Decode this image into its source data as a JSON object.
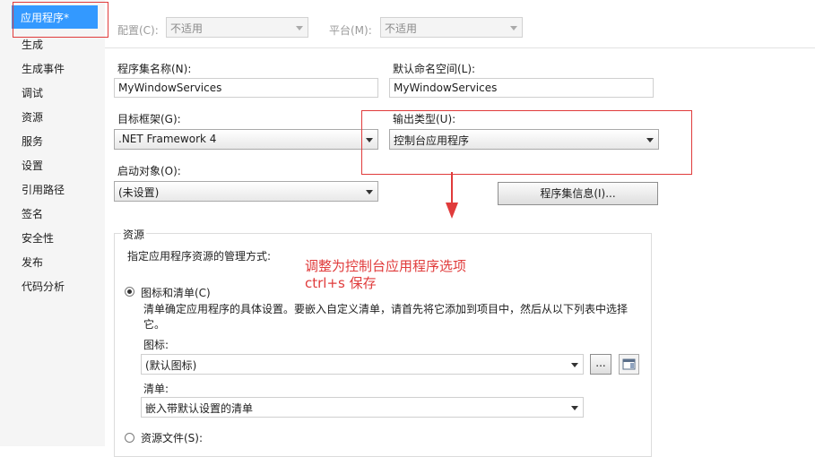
{
  "sidebar": {
    "active": "应用程序*",
    "items": [
      "生成",
      "生成事件",
      "调试",
      "资源",
      "服务",
      "设置",
      "引用路径",
      "签名",
      "安全性",
      "发布",
      "代码分析"
    ]
  },
  "toolbar": {
    "config_label": "配置(C):",
    "config_value": "不适用",
    "platform_label": "平台(M):",
    "platform_value": "不适用"
  },
  "form": {
    "assembly_name_label": "程序集名称(N):",
    "assembly_name_value": "MyWindowServices",
    "namespace_label": "默认命名空间(L):",
    "namespace_value": "MyWindowServices",
    "target_framework_label": "目标框架(G):",
    "target_framework_value": ".NET Framework 4",
    "output_type_label": "输出类型(U):",
    "output_type_value": "控制台应用程序",
    "startup_object_label": "启动对象(O):",
    "startup_object_value": "(未设置)",
    "assembly_info_button": "程序集信息(I)..."
  },
  "resources": {
    "group_title": "资源",
    "intro": "指定应用程序资源的管理方式:",
    "option_icon_manifest": "图标和清单(C)",
    "manifest_desc": "清单确定应用程序的具体设置。要嵌入自定义清单，请首先将它添加到项目中，然后从以下列表中选择它。",
    "icon_label": "图标:",
    "icon_value": "(默认图标)",
    "browse_label": "...",
    "manifest_label": "清单:",
    "manifest_value": "嵌入带默认设置的清单",
    "option_resource_file": "资源文件(S):"
  },
  "annotation": {
    "line1": "调整为控制台应用程序选项",
    "line2": "ctrl+s 保存"
  },
  "colors": {
    "accent": "#3399ff",
    "annotation": "#e03b3b"
  }
}
